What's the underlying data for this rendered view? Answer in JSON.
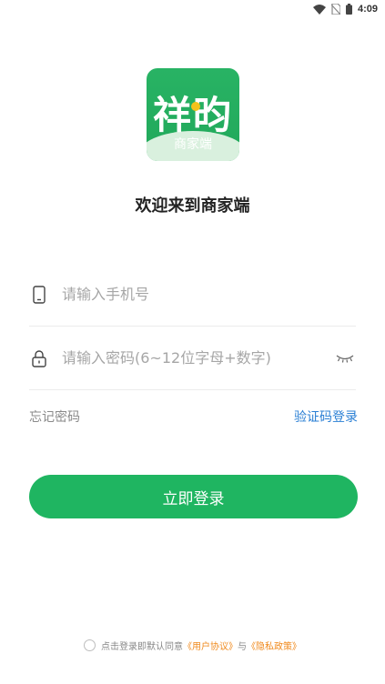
{
  "status_bar": {
    "time": "4:09",
    "icons": [
      "wifi-icon",
      "no-sim-icon",
      "battery-icon"
    ]
  },
  "logo": {
    "brand": "祥昀",
    "subtitle": "商家端"
  },
  "welcome_text": "欢迎来到商家端",
  "phone_field": {
    "placeholder": "请输入手机号",
    "value": "",
    "icon": "phone-icon"
  },
  "password_field": {
    "placeholder": "请输入密码(6~12位字母+数字)",
    "value": "",
    "icon": "lock-icon",
    "toggle_icon": "eye-closed-icon"
  },
  "links": {
    "forgot_password": "忘记密码",
    "sms_login": "验证码登录"
  },
  "login_button": "立即登录",
  "agreement": {
    "prefix": "点击登录即默认同意",
    "user_agreement": "《用户协议》",
    "connector": "与",
    "privacy_policy": "《隐私政策》",
    "checked": false
  },
  "colors": {
    "primary_green": "#1fb561",
    "link_blue": "#2a7fd4",
    "agreement_orange": "#f08a1d"
  }
}
